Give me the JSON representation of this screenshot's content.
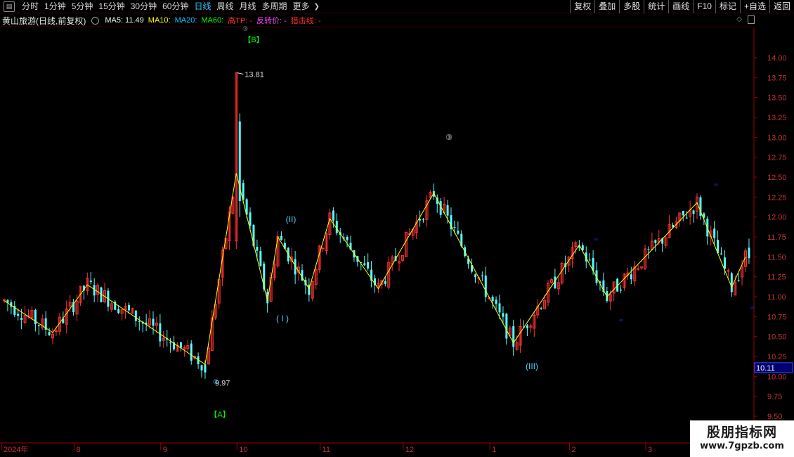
{
  "toolbar": {
    "menu_icon": "grid-icon",
    "periods": [
      "分时",
      "1分钟",
      "5分钟",
      "15分钟",
      "30分钟",
      "60分钟",
      "日线",
      "周线",
      "月线",
      "多周期",
      "更多"
    ],
    "active_period": "日线",
    "buttons": [
      "复权",
      "叠加",
      "多股",
      "统计",
      "画线",
      "F10",
      "标记",
      "+自选",
      "返回"
    ]
  },
  "info": {
    "stock_title": "黄山旅游(日线,前复权)",
    "ma5": "MA5: 11.49",
    "ma10": "MA10:",
    "ma20": "MA20:",
    "ma60": "MA60:",
    "high_tp": "高TP: -",
    "reversal": "反转价: -",
    "snipe": "猎击线: -"
  },
  "watermark": {
    "line1": "股朋指标网",
    "line2": "www.7gpzb.com"
  },
  "colors": {
    "up": "#ff3232",
    "down": "#54ffff",
    "zigzag": "#ffff00",
    "grid": "#5a0000",
    "axis": "#a00000"
  },
  "chart_data": {
    "type": "candlestick",
    "y_ticks": [
      "9.50",
      "9.75",
      "10.00",
      "10.25",
      "10.50",
      "10.75",
      "11.00",
      "11.25",
      "11.50",
      "11.75",
      "12.00",
      "12.25",
      "12.50",
      "12.75",
      "13.00",
      "13.25",
      "13.50",
      "13.75",
      "14.00"
    ],
    "ylim": [
      9.5,
      14.0
    ],
    "x_labels": [
      "2024年",
      "8",
      "9",
      "10",
      "11",
      "12",
      "1",
      "2",
      "3"
    ],
    "current_price": "10.11",
    "annotations": {
      "high_price": "13.81",
      "low_price": "9.97",
      "wave_A": "【A】",
      "wave_B": "【B】",
      "wave_I": "( I )",
      "wave_II": "(II)",
      "wave_III": "(III)",
      "circle_3": "③"
    },
    "zigzag": [
      {
        "bar": 0,
        "y": 10.95
      },
      {
        "bar": 14,
        "y": 10.55
      },
      {
        "bar": 24,
        "y": 11.15
      },
      {
        "bar": 58,
        "y": 10.15
      },
      {
        "bar": 67,
        "y": 12.55
      },
      {
        "bar": 76,
        "y": 10.95
      },
      {
        "bar": 79,
        "y": 11.75
      },
      {
        "bar": 88,
        "y": 11.1
      },
      {
        "bar": 94,
        "y": 11.98
      },
      {
        "bar": 108,
        "y": 11.1
      },
      {
        "bar": 124,
        "y": 12.3
      },
      {
        "bar": 147,
        "y": 10.42
      },
      {
        "bar": 166,
        "y": 11.65
      },
      {
        "bar": 174,
        "y": 11.0
      },
      {
        "bar": 200,
        "y": 12.18
      },
      {
        "bar": 210,
        "y": 11.12
      },
      {
        "bar": 214,
        "y": 11.5
      }
    ],
    "candles": []
  }
}
